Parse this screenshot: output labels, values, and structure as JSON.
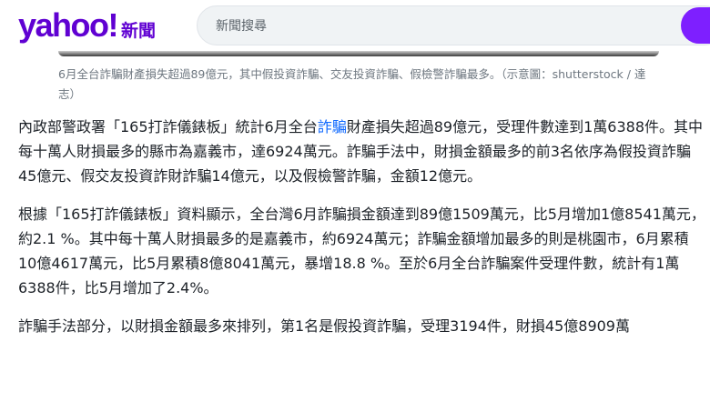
{
  "header": {
    "logo_text": "yahoo!",
    "section_label": "新聞",
    "search_placeholder": "新聞搜尋"
  },
  "image_caption": {
    "text": "6月全台詐騙財產損失超過89億元，其中假投資詐騙、交友投資詐騙、假檢警詐騙最多。（示意圖：shutterstock / 達志）"
  },
  "article": {
    "p1_before_link": "內政部警政署「165打詐儀錶板」統計6月全台",
    "p1_link": "詐騙",
    "p1_after_link": "財產損失超過89億元，受理件數達到1萬6388件。其中每十萬人財損最多的縣市為嘉義市，達6924萬元。詐騙手法中，財損金額最多的前3名依序為假投資詐騙45億元、假交友投資詐財詐騙14億元，以及假檢警詐騙，金額12億元。",
    "p2": "根據「165打詐儀錶板」資料顯示，全台灣6月詐騙損金額達到89億1509萬元，比5月增加1億8541萬元，約2.1 %。其中每十萬人財損最多的是嘉義市，約6924萬元；詐騙金額增加最多的則是桃園市，6月累積10億4617萬元，比5月累積8億8041萬元，暴增18.8 %。至於6月全台詐騙案件受理件數，統計有1萬6388件，比5月增加了2.4%。",
    "p3": "詐騙手法部分，以財損金額最多來排列，第1名是假投資詐騙，受理3194件，財損45億8909萬"
  },
  "colors": {
    "brand": "#6001d2",
    "link": "#0f69ff",
    "search_button": "#7e1fff"
  }
}
